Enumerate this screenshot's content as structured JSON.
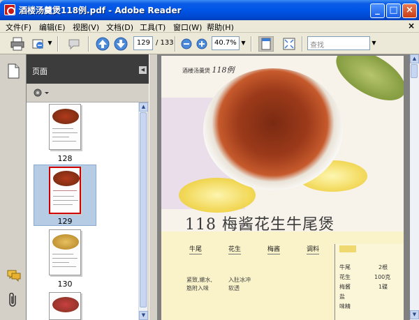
{
  "window": {
    "title": "酒楼汤羹煲118例.pdf - Adobe Reader",
    "min": "_",
    "max": "□",
    "close": "×"
  },
  "menu": {
    "items": [
      "文件(F)",
      "编辑(E)",
      "视图(V)",
      "文档(D)",
      "工具(T)",
      "窗口(W)",
      "帮助(H)"
    ],
    "doc_close": "×"
  },
  "toolbar": {
    "page_current": "129",
    "page_total": "/ 133",
    "zoom": "40.7%",
    "search_placeholder": "查找"
  },
  "pages_panel": {
    "title": "页面",
    "collapse": "◀",
    "thumbnails": [
      {
        "label": "128",
        "selected": false
      },
      {
        "label": "129",
        "selected": true
      },
      {
        "label": "130",
        "selected": false
      }
    ]
  },
  "document": {
    "header_text": "酒楼汤羹煲",
    "header_num": "118例",
    "dish_title": "118 梅酱花生牛尾煲",
    "columns": [
      {
        "head": "牛尾"
      },
      {
        "head": "花生"
      },
      {
        "head": "梅酱"
      },
      {
        "head": "调料"
      }
    ],
    "column_text": [
      "紧致,嫩水,",
      "入肚冰冲",
      "筋附入味",
      "软透"
    ],
    "ingredients": [
      {
        "name": "牛尾",
        "qty": "2根"
      },
      {
        "name": "花生",
        "qty": "100克"
      },
      {
        "name": "梅酱",
        "qty": "1碟"
      },
      {
        "name": "盐",
        "qty": ""
      },
      {
        "name": "味精",
        "qty": ""
      }
    ]
  },
  "colors": {
    "titlebar": "#0055e5",
    "selected_thumb": "#b6cbe4",
    "panel_header": "#3c3c3c"
  }
}
